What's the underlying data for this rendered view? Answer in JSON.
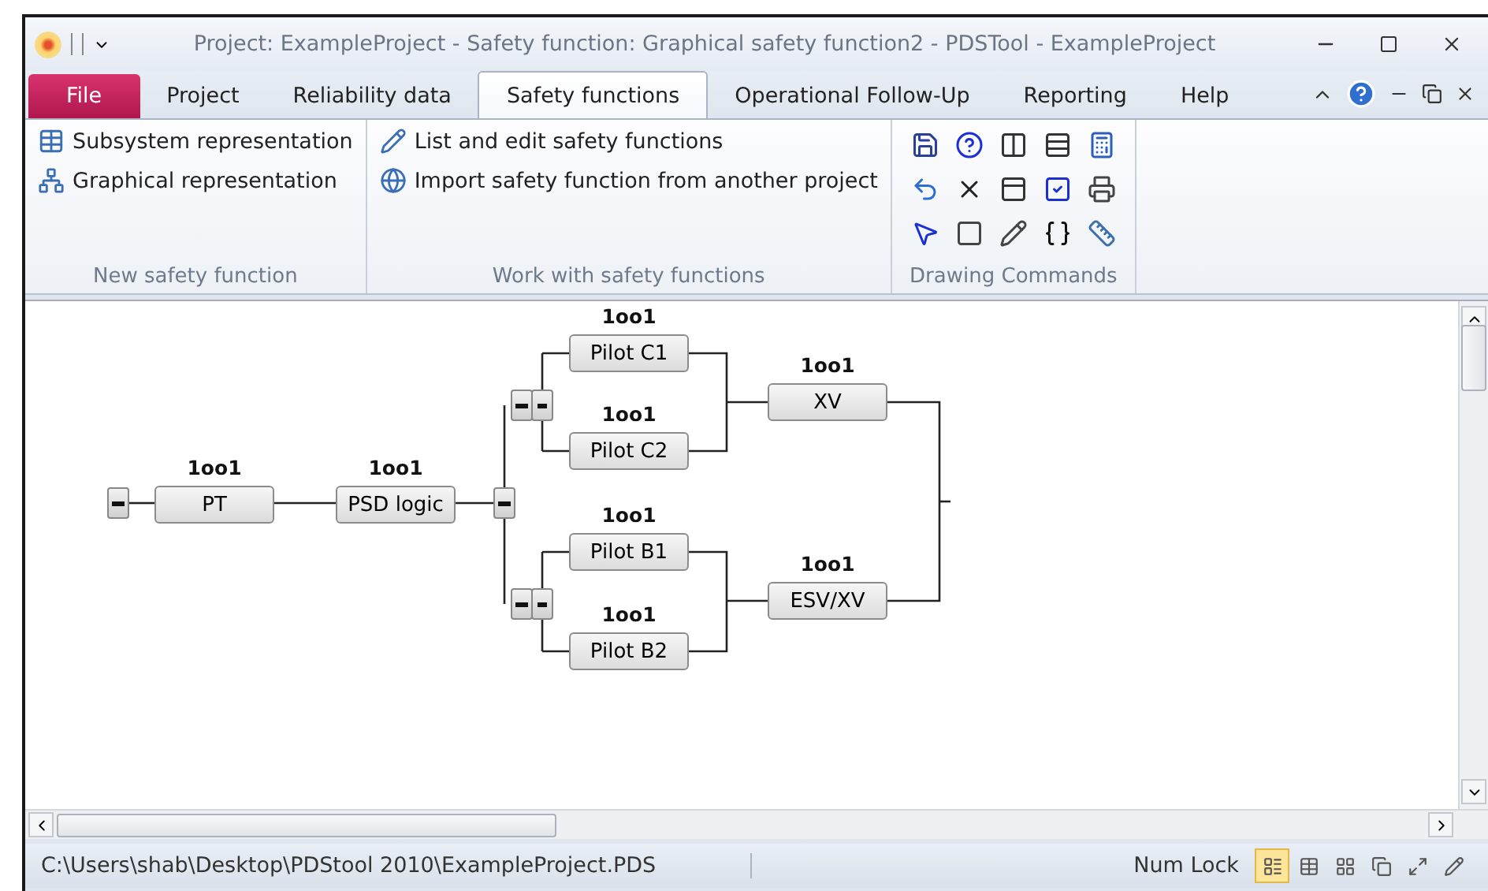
{
  "window": {
    "title": "Project: ExampleProject - Safety function: Graphical safety function2  -  PDSTool - ExampleProject"
  },
  "tabs": [
    {
      "label": "File",
      "kind": "file",
      "selected": false
    },
    {
      "label": "Project",
      "kind": "tab",
      "selected": false
    },
    {
      "label": "Reliability data",
      "kind": "tab",
      "selected": false
    },
    {
      "label": "Safety functions",
      "kind": "tab",
      "selected": true
    },
    {
      "label": "Operational Follow-Up",
      "kind": "tab",
      "selected": false
    },
    {
      "label": "Reporting",
      "kind": "tab",
      "selected": false
    },
    {
      "label": "Help",
      "kind": "tab",
      "selected": false
    }
  ],
  "ribbon": {
    "groups": [
      {
        "label": "New safety function",
        "items": [
          {
            "label": "Subsystem representation"
          },
          {
            "label": "Graphical representation"
          }
        ]
      },
      {
        "label": "Work with safety functions",
        "items": [
          {
            "label": "List and edit safety functions"
          },
          {
            "label": "Import safety function from another project"
          }
        ]
      },
      {
        "label": "Drawing Commands",
        "kind": "icons"
      }
    ]
  },
  "diagram": {
    "nodes": [
      {
        "label": "PT",
        "vote": "1oo1"
      },
      {
        "label": "PSD logic",
        "vote": "1oo1"
      },
      {
        "label": "Pilot C1",
        "vote": "1oo1"
      },
      {
        "label": "Pilot C2",
        "vote": "1oo1"
      },
      {
        "label": "Pilot B1",
        "vote": "1oo1"
      },
      {
        "label": "Pilot B2",
        "vote": "1oo1"
      },
      {
        "label": "XV",
        "vote": "1oo1"
      },
      {
        "label": "ESV/XV",
        "vote": "1oo1"
      }
    ]
  },
  "status_bar": {
    "path": "C:\\Users\\shab\\Desktop\\PDStool 2010\\ExampleProject.PDS",
    "indicator": "Num Lock",
    "views": [
      {
        "selected": true
      },
      {
        "selected": false
      },
      {
        "selected": false
      },
      {
        "selected": false
      },
      {
        "selected": false
      },
      {
        "selected": false
      }
    ]
  }
}
